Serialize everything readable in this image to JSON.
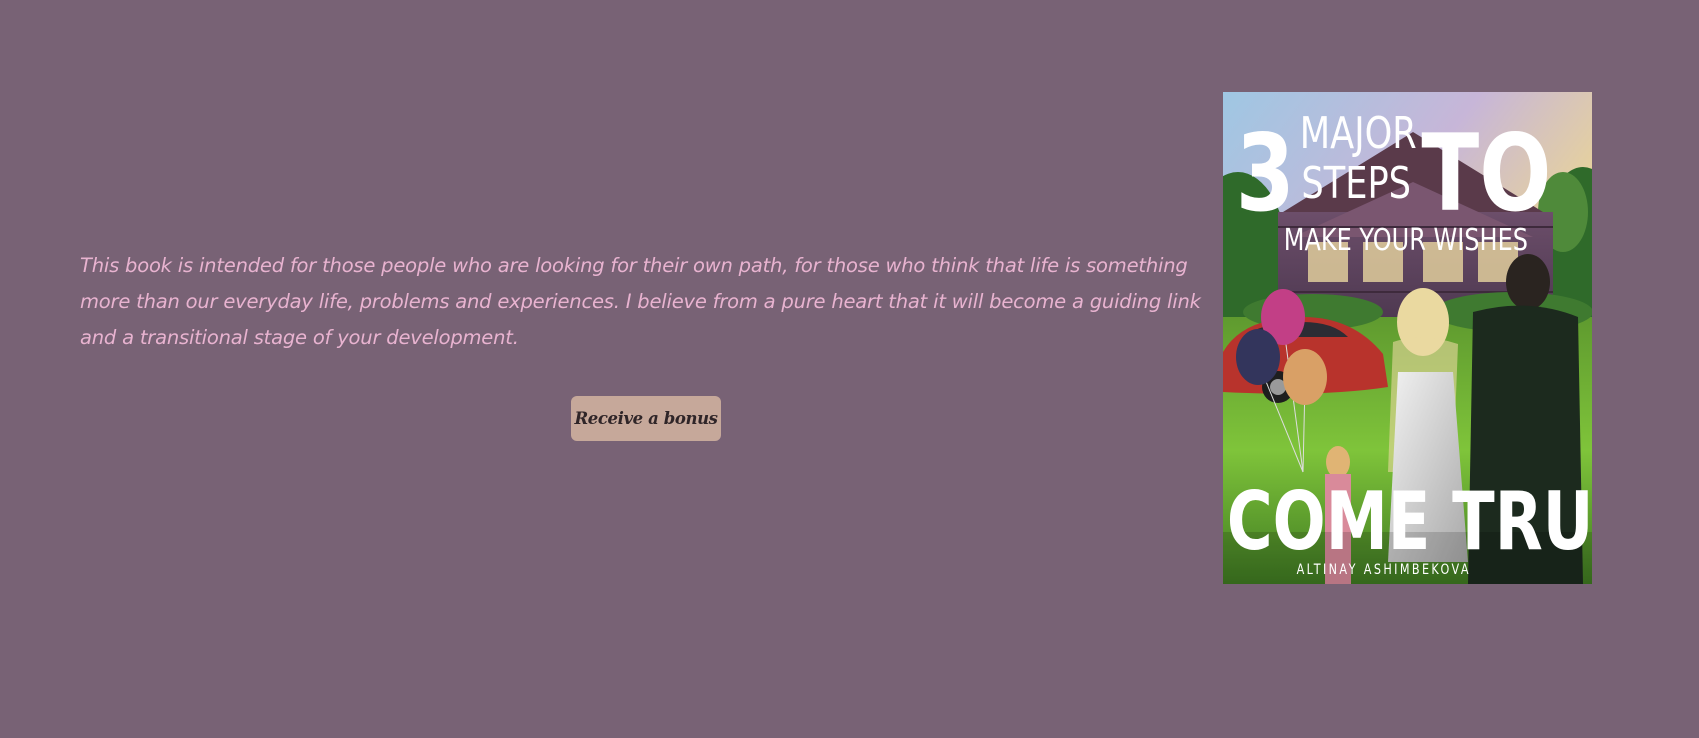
{
  "book": {
    "description": "This book is intended for those people who are looking for their own path, for those who think that life is something more than our everyday life, problems and experiences. I believe from a pure heart that it will become a guiding link and a transitional stage of your development.",
    "bonus_button_label": "Receive a bonus",
    "cover": {
      "number": "3",
      "line1": "MAJOR",
      "line2": "STEPS",
      "to": "TO",
      "subtitle": "MAKE YOUR WISHES",
      "title_bottom": "COME TRUE",
      "author": "ALTINAY ASHIMBEKOVA"
    }
  },
  "colors": {
    "background": "#786275",
    "text": "#e8b3d0",
    "button_bg": "#c6a89a",
    "button_text": "#2f2528"
  }
}
